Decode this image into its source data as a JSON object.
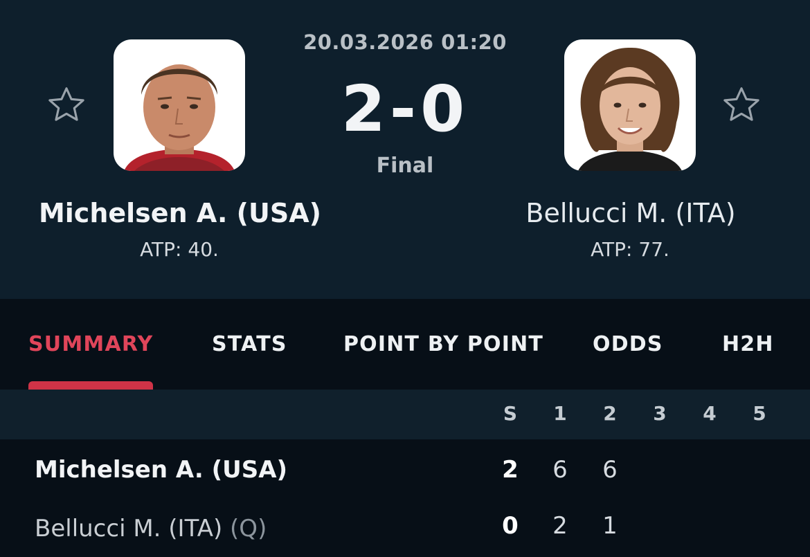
{
  "match": {
    "datetime": "20.03.2026 01:20",
    "score": "2-0",
    "status": "Final"
  },
  "players": {
    "home": {
      "name": "Michelsen A. (USA)",
      "rank": "ATP: 40.",
      "avatar_colors": {
        "skin": "#c98a6a",
        "hair": "#4a3322",
        "shirt": "#b4222c"
      }
    },
    "away": {
      "name": "Bellucci M. (ITA)",
      "rank": "ATP: 77.",
      "avatar_colors": {
        "skin": "#e2b79b",
        "hair": "#5b3a22",
        "shirt": "#1b1b1b"
      }
    }
  },
  "icons": {
    "favorite_left": "star-outline-icon",
    "favorite_right": "star-outline-icon"
  },
  "tabs": [
    {
      "label": "SUMMARY",
      "active": true
    },
    {
      "label": "STATS",
      "active": false
    },
    {
      "label": "POINT BY POINT",
      "active": false
    },
    {
      "label": "ODDS",
      "active": false
    },
    {
      "label": "H2H",
      "active": false
    }
  ],
  "scoreboard": {
    "columns": [
      "S",
      "1",
      "2",
      "3",
      "4",
      "5"
    ],
    "rows": [
      {
        "name": "Michelsen A. (USA)",
        "qualifier": "",
        "sets": "2",
        "games": [
          "6",
          "6",
          "",
          "",
          ""
        ]
      },
      {
        "name": "Bellucci M. (ITA)",
        "qualifier": "(Q)",
        "sets": "0",
        "games": [
          "2",
          "1",
          "",
          "",
          ""
        ]
      }
    ]
  },
  "colors": {
    "accent": "#e0455a",
    "header_bg": "#0e1f2c",
    "page_bg": "#070f17"
  }
}
